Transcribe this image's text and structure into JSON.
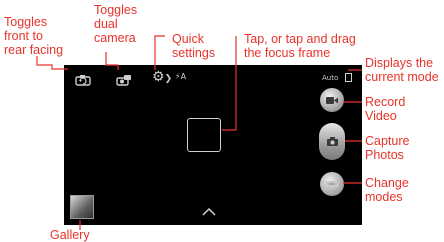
{
  "callouts": {
    "toggle_facing": "Toggles\nfront to\nrear facing",
    "dual_camera": "Toggles\ndual\ncamera",
    "quick_settings": "Quick\nsettings",
    "focus": "Tap, or tap and drag\nthe focus frame",
    "current_mode": "Displays the\ncurrent mode",
    "record": "Record\nVideo",
    "capture": "Capture\nPhotos",
    "change_modes": "Change\nmodes",
    "gallery": "Gallery"
  },
  "screen": {
    "mode_indicator": "Auto",
    "flash_label": "⚡A",
    "icons": {
      "switch_camera": "switch-camera-icon",
      "dual_camera": "dual-camera-icon",
      "settings": "settings-gear-icon",
      "flash": "flash-auto-icon",
      "video": "video-camera-icon",
      "photo": "camera-icon",
      "mode": "mode-switch-icon",
      "chevron": "chevron-up-icon"
    }
  },
  "colors": {
    "callout": "#e8332a",
    "screen_bg": "#000000",
    "icon": "#cfcfcf"
  }
}
